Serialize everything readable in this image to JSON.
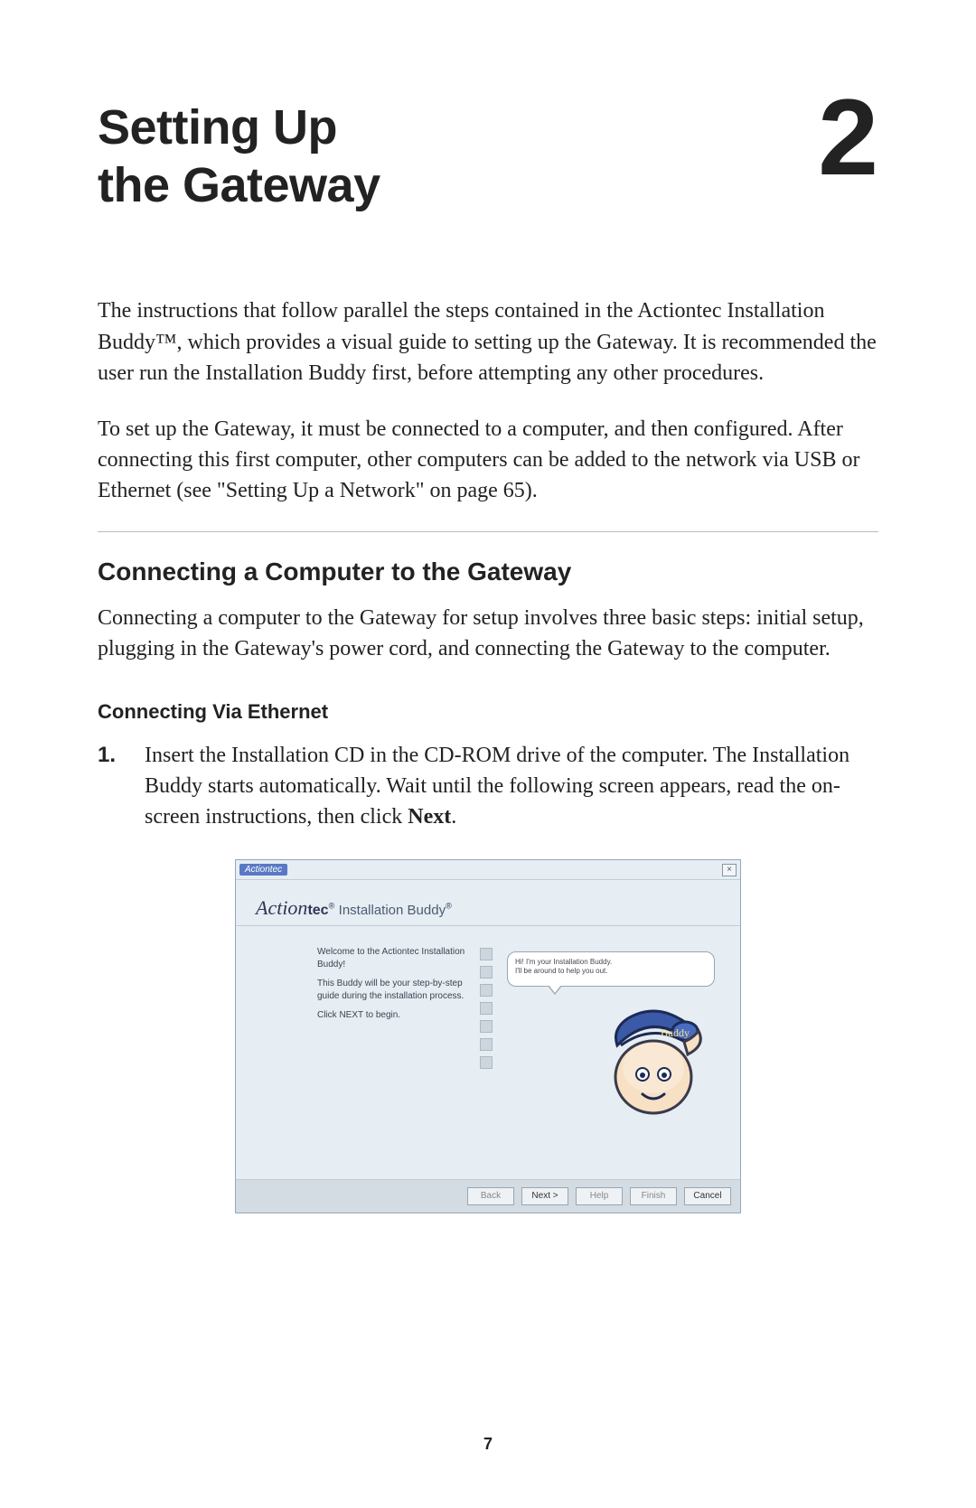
{
  "chapter": {
    "title_line1": "Setting Up",
    "title_line2": "the Gateway",
    "number": "2"
  },
  "paragraphs": {
    "intro1": "The instructions that follow parallel the steps contained in the Actiontec Installation Buddy™, which provides a visual guide to setting up the Gateway. It is recommended the user run the Installation Buddy first, before attempting any other procedures.",
    "intro2": "To set up the Gateway, it must be connected to a computer, and then configured. After connecting this first computer, other computers can be added to the network via USB or Ethernet (see \"Setting Up a Network\" on page 65)."
  },
  "sections": {
    "h2": "Connecting a Computer to the Gateway",
    "h2_body": "Connecting a computer to the Gateway for setup involves three basic steps: initial setup, plugging in the Gateway's power cord, and connecting the Gateway to the computer.",
    "h3": "Connecting Via Ethernet"
  },
  "step1": {
    "num": "1.",
    "text_pre": "Insert the Installation CD in the CD-ROM drive of the computer. The Installation Buddy starts automatically. Wait until the following screen appears, read the on-screen instructions, then click ",
    "text_bold": "Next",
    "text_post": "."
  },
  "figure": {
    "title_chip": "Actiontec",
    "close": "×",
    "brand_action": "Action",
    "brand_tec": "tec",
    "brand_reg": "®",
    "brand_product": " Installation Buddy",
    "instr_welcome": "Welcome to the Actiontec Installation Buddy!",
    "instr_body": "This Buddy will be your step-by-step guide during the installation process.",
    "instr_click": "Click NEXT to begin.",
    "speech_line1": "Hi! I'm your Installation Buddy.",
    "speech_line2": "I'll be around to help you out.",
    "speech_sig": "Buddy",
    "buttons": {
      "back": "Back",
      "next": "Next >",
      "help": "Help",
      "finish": "Finish",
      "cancel": "Cancel"
    }
  },
  "page_number": "7"
}
